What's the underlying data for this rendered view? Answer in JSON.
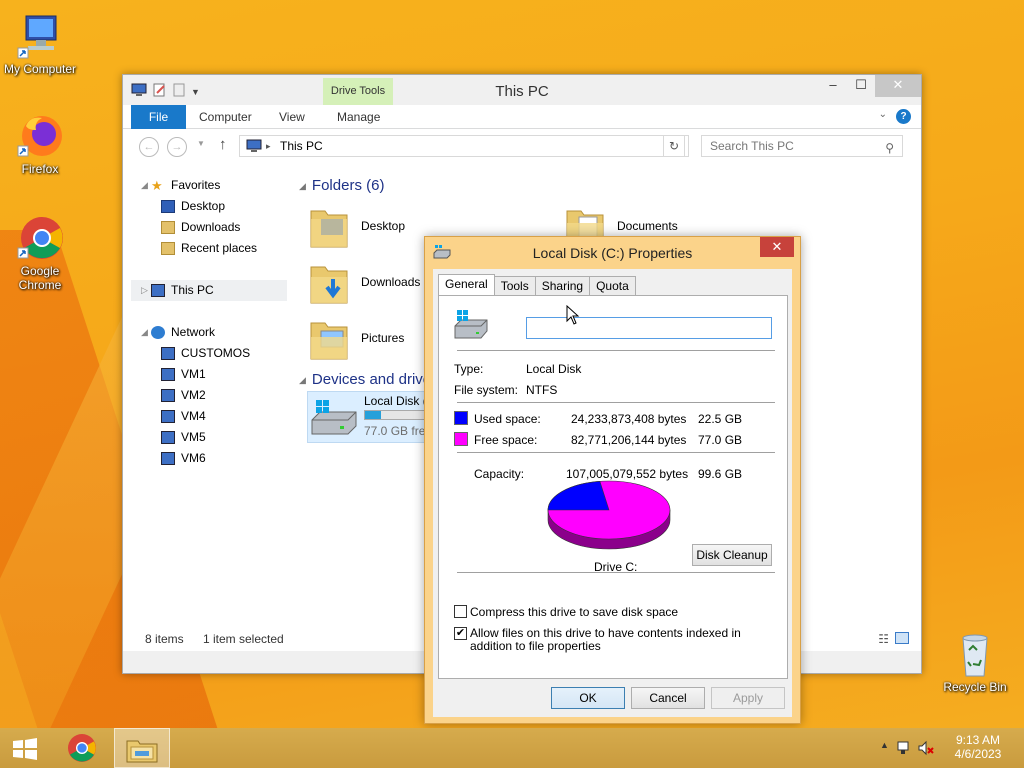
{
  "desktop": {
    "icons": [
      {
        "label": "My Computer"
      },
      {
        "label": "Firefox"
      },
      {
        "label": "Google Chrome"
      },
      {
        "label": "Recycle Bin"
      }
    ]
  },
  "explorer": {
    "title": "This PC",
    "contextual_tab": "Drive Tools",
    "tabs": {
      "file": "File",
      "computer": "Computer",
      "view": "View",
      "manage": "Manage"
    },
    "address": "This PC",
    "search_placeholder": "Search This PC",
    "nav": {
      "favorites": "Favorites",
      "desktop": "Desktop",
      "downloads": "Downloads",
      "recent": "Recent places",
      "this_pc": "This PC",
      "network": "Network",
      "network_items": [
        "CUSTOMOS",
        "VM1",
        "VM2",
        "VM4",
        "VM5",
        "VM6"
      ]
    },
    "folders_header": "Folders (6)",
    "folders": [
      "Desktop",
      "Documents",
      "Downloads",
      "Pictures"
    ],
    "devices_header": "Devices and drive",
    "drive": {
      "name": "Local Disk (C",
      "free": "77.0 GB free",
      "used_fraction": 0.23
    },
    "status": {
      "items": "8 items",
      "selected": "1 item selected"
    }
  },
  "props": {
    "title": "Local Disk (C:) Properties",
    "tabs": [
      "General",
      "Tools",
      "Sharing",
      "Quota"
    ],
    "label_value": "",
    "type_label": "Type:",
    "type_value": "Local Disk",
    "fs_label": "File system:",
    "fs_value": "NTFS",
    "used_label": "Used space:",
    "used_bytes": "24,233,873,408 bytes",
    "used_gb": "22.5 GB",
    "free_label": "Free space:",
    "free_bytes": "82,771,206,144 bytes",
    "free_gb": "77.0 GB",
    "capacity_label": "Capacity:",
    "capacity_bytes": "107,005,079,552 bytes",
    "capacity_gb": "99.6 GB",
    "drive_label": "Drive C:",
    "cleanup": "Disk Cleanup",
    "compress": "Compress this drive to save disk space",
    "index": "Allow files on this drive to have contents indexed in addition to file properties",
    "ok": "OK",
    "cancel": "Cancel",
    "apply": "Apply",
    "colors": {
      "used": "#0000ff",
      "free": "#ff00ff"
    },
    "compress_checked": false,
    "index_checked": true
  },
  "taskbar": {
    "time": "9:13 AM",
    "date": "4/6/2023"
  }
}
